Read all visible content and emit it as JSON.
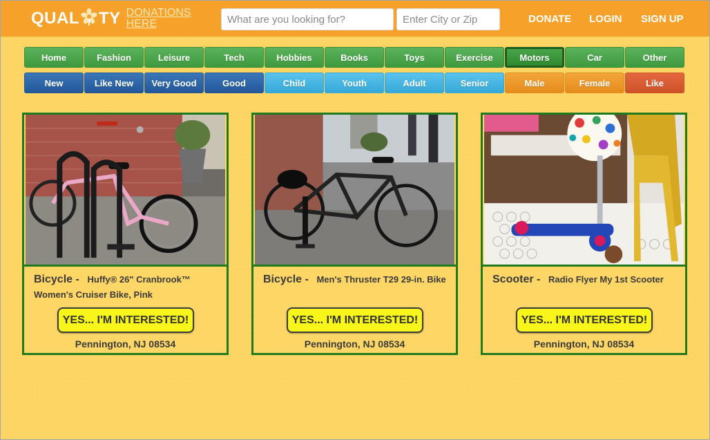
{
  "header": {
    "logo_main_left": "QUAL",
    "logo_main_right": "TY",
    "logo_sub_1": "DONATIONS",
    "logo_sub_2": "HERE",
    "search_placeholder": "What are you looking for?",
    "city_placeholder": "Enter City or Zip",
    "links": [
      "DONATE",
      "LOGIN",
      "SIGN UP"
    ]
  },
  "categories": [
    {
      "label": "Home",
      "style": "green"
    },
    {
      "label": "Fashion",
      "style": "green"
    },
    {
      "label": "Leisure",
      "style": "green"
    },
    {
      "label": "Tech",
      "style": "green"
    },
    {
      "label": "Hobbies",
      "style": "green"
    },
    {
      "label": "Books",
      "style": "green"
    },
    {
      "label": "Toys",
      "style": "green"
    },
    {
      "label": "Exercise",
      "style": "green"
    },
    {
      "label": "Motors",
      "style": "green active"
    },
    {
      "label": "Car",
      "style": "green"
    },
    {
      "label": "Other",
      "style": "green"
    }
  ],
  "filters": [
    {
      "label": "New",
      "style": "blue-dark"
    },
    {
      "label": "Like New",
      "style": "blue-dark"
    },
    {
      "label": "Very Good",
      "style": "blue-dark"
    },
    {
      "label": "Good",
      "style": "blue-dark"
    },
    {
      "label": "Child",
      "style": "blue-light"
    },
    {
      "label": "Youth",
      "style": "blue-light"
    },
    {
      "label": "Adult",
      "style": "blue-light"
    },
    {
      "label": "Senior",
      "style": "blue-light"
    },
    {
      "label": "Male",
      "style": "orange"
    },
    {
      "label": "Female",
      "style": "orange"
    },
    {
      "label": "Like",
      "style": "red"
    }
  ],
  "listings": [
    {
      "type": "Bicycle -",
      "name": "Huffy® 26\" Cranbrook™ Women's Cruiser Bike, Pink",
      "button": "YES... I'M INTERESTED!",
      "location": "Pennington, NJ 08534"
    },
    {
      "type": "Bicycle -",
      "name": "Men's Thruster T29 29-in. Bike",
      "button": "YES... I'M INTERESTED!",
      "location": "Pennington, NJ 08534"
    },
    {
      "type": "Scooter -",
      "name": "Radio Flyer My 1st Scooter",
      "button": "YES... I'M INTERESTED!",
      "location": "Pennington, NJ 08534"
    }
  ],
  "colors": {
    "header": "#f6a12a",
    "background": "#fdd666",
    "card_border": "#1e7a1e",
    "interest_button": "#f7f51a"
  }
}
